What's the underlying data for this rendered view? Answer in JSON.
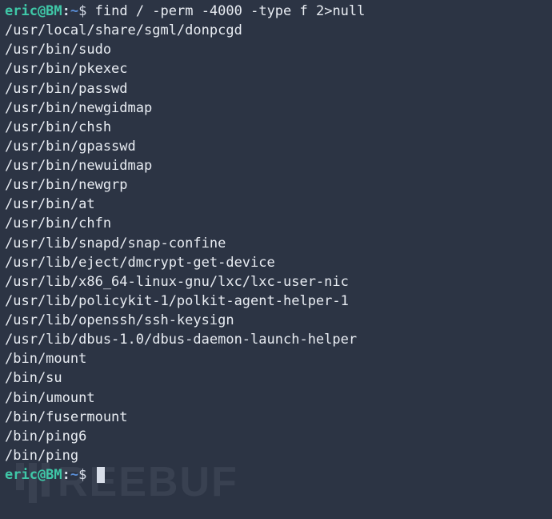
{
  "prompt1": {
    "user": "eric@BM",
    "colon": ":",
    "path": "~",
    "dollar": "$ ",
    "command": "find / -perm -4000 -type f 2>null"
  },
  "output_lines": [
    "/usr/local/share/sgml/donpcgd",
    "/usr/bin/sudo",
    "/usr/bin/pkexec",
    "/usr/bin/passwd",
    "/usr/bin/newgidmap",
    "/usr/bin/chsh",
    "/usr/bin/gpasswd",
    "/usr/bin/newuidmap",
    "/usr/bin/newgrp",
    "/usr/bin/at",
    "/usr/bin/chfn",
    "/usr/lib/snapd/snap-confine",
    "/usr/lib/eject/dmcrypt-get-device",
    "/usr/lib/x86_64-linux-gnu/lxc/lxc-user-nic",
    "/usr/lib/policykit-1/polkit-agent-helper-1",
    "/usr/lib/openssh/ssh-keysign",
    "/usr/lib/dbus-1.0/dbus-daemon-launch-helper",
    "/bin/mount",
    "/bin/su",
    "/bin/umount",
    "/bin/fusermount",
    "/bin/ping6",
    "/bin/ping"
  ],
  "prompt2": {
    "user": "eric@BM",
    "colon": ":",
    "path": "~",
    "dollar": "$ "
  },
  "watermark_text": "REEBUF"
}
